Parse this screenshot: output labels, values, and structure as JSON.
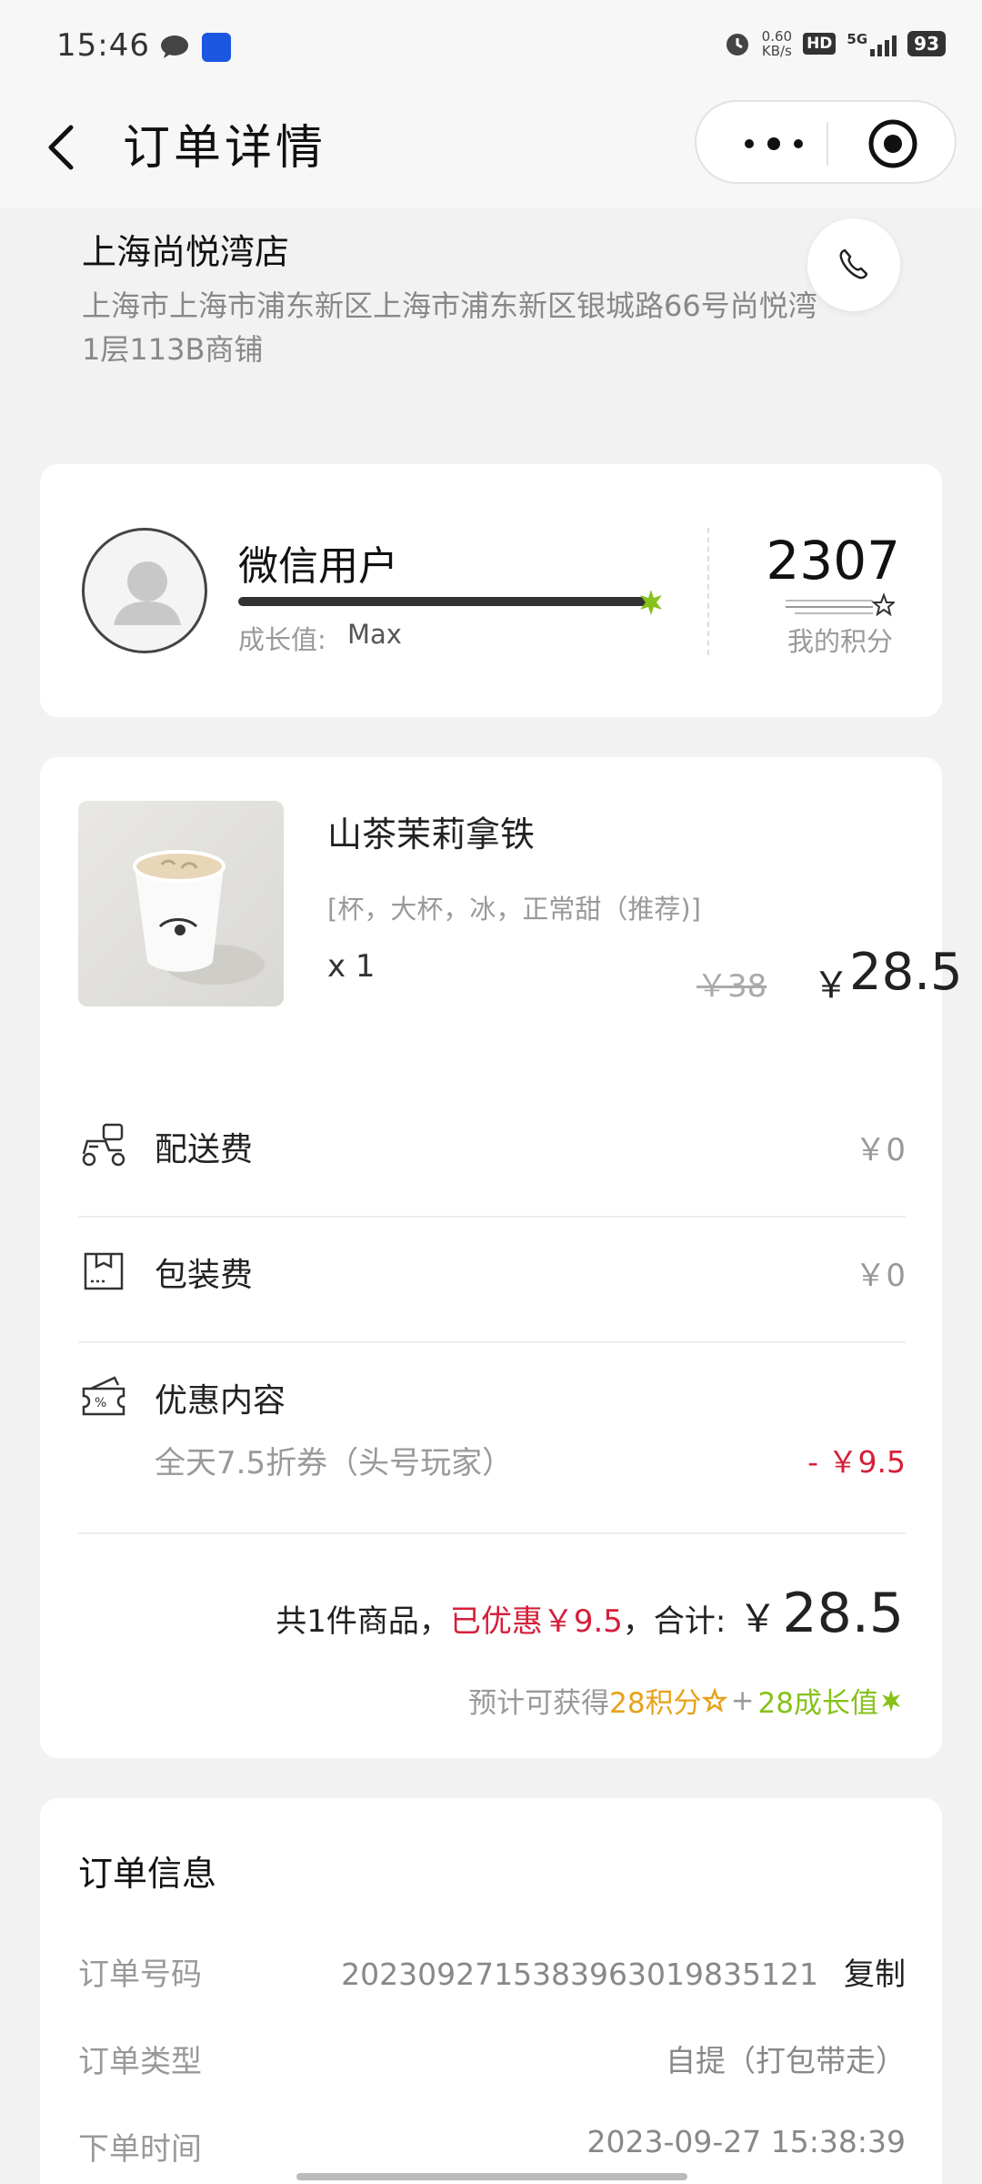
{
  "status_bar": {
    "time": "15:46",
    "net_speed_value": "0.60",
    "net_speed_unit": "KB/s",
    "hd": "HD",
    "network": "5G",
    "battery": "93"
  },
  "nav": {
    "title": "订单详情"
  },
  "store": {
    "name": "上海尚悦湾店",
    "address": "上海市上海市浦东新区上海市浦东新区银城路66号尚悦湾1层113B商铺"
  },
  "user": {
    "name": "微信用户",
    "growth_label": "成长值:",
    "growth_value": "Max",
    "growth_progress": 1.0,
    "points": "2307",
    "points_label": "我的积分"
  },
  "product": {
    "name": "山茶茉莉拿铁",
    "spec": "[杯，大杯，冰，正常甜（推荐)]",
    "quantity": "x 1",
    "original_price": "￥38",
    "currency": "￥",
    "price": "28.5"
  },
  "fees": {
    "delivery_label": "配送费",
    "delivery_value": "￥0",
    "packing_label": "包装费",
    "packing_value": "￥0",
    "discount_label": "优惠内容",
    "discount_desc": "全天7.5折券（头号玩家）",
    "discount_value": "- ￥9.5"
  },
  "summary": {
    "count_text": "共1件商品，",
    "saved_text": "已优惠￥9.5",
    "total_label": "，合计:",
    "currency": "￥",
    "total": "28.5",
    "earn_label": "预计可获得",
    "earn_points": "28积分",
    "plus": "+",
    "earn_growth": "28成长值"
  },
  "order_info": {
    "title": "订单信息",
    "order_no_label": "订单号码",
    "order_no": "202309271538396301983512​1",
    "copy_label": "复制",
    "order_type_label": "订单类型",
    "order_type": "自提（打包带走）",
    "order_time_label": "下单时间",
    "order_time": "2023-09-27 15:38:39"
  },
  "colors": {
    "accent_red": "#d61f3b",
    "points_gold": "#e6a21a",
    "growth_green": "#86c21a",
    "app_icon_blue": "#1b57e0"
  }
}
